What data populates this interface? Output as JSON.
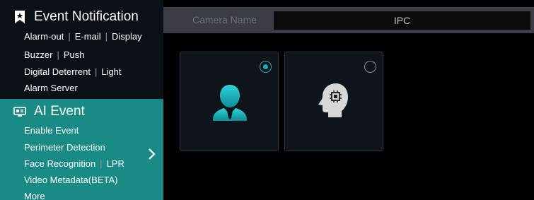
{
  "sidebar": {
    "event_notification": {
      "title": "Event Notification",
      "icon": "bookmark-star-icon",
      "rows": [
        [
          "Alarm-out",
          "E-mail",
          "Display"
        ],
        [
          "Buzzer",
          "Push"
        ],
        [
          "Digital Deterrent",
          "Light"
        ],
        [
          "Alarm Server"
        ]
      ]
    },
    "ai_event": {
      "title": "AI Event",
      "icon": "ai-camera-icon",
      "rows": [
        [
          "Enable Event"
        ],
        [
          "Perimeter Detection"
        ],
        [
          "Face Recognition",
          "LPR"
        ],
        [
          "Video Metadata(BETA)"
        ],
        [
          "More"
        ]
      ]
    },
    "chevron_icon": "chevron-right-icon"
  },
  "topbar": {
    "camera_label": "Camera Name",
    "camera_value": "IPC"
  },
  "cards": [
    {
      "icon": "person-icon",
      "selected": true
    },
    {
      "icon": "ai-head-icon",
      "selected": false
    }
  ],
  "colors": {
    "accent": "#1bb0b4",
    "ai_section_bg": "#1a8a84",
    "event_section_bg": "#0b1017"
  }
}
